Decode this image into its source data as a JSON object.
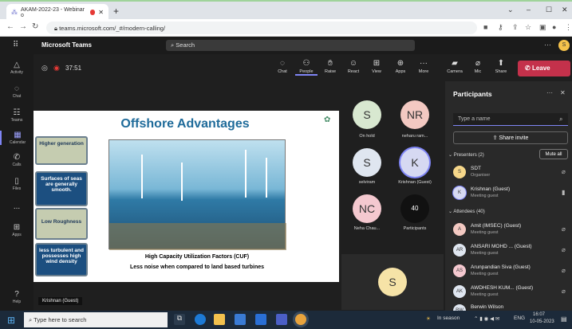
{
  "browser": {
    "tab_title": "AKAM-2022-23 - Webinar o",
    "tab_close": "✕",
    "new_tab": "+",
    "url": "teams.microsoft.com/_#/modern-calling/",
    "window_controls": [
      "⌄",
      "–",
      "☐",
      "✕"
    ]
  },
  "teams": {
    "app_title": "Microsoft Teams",
    "search_placeholder": "Search",
    "user_initial": "S"
  },
  "rail": [
    {
      "label": "Activity",
      "icon": "bell-icon"
    },
    {
      "label": "Chat",
      "icon": "chat-icon"
    },
    {
      "label": "Teams",
      "icon": "teams-icon"
    },
    {
      "label": "Calendar",
      "icon": "calendar-icon"
    },
    {
      "label": "Calls",
      "icon": "phone-icon"
    },
    {
      "label": "Files",
      "icon": "file-icon"
    },
    {
      "label": "...",
      "icon": "more-icon"
    },
    {
      "label": "Apps",
      "icon": "apps-icon"
    },
    {
      "label": "Help",
      "icon": "help-icon"
    }
  ],
  "meeting": {
    "timer": "37:51",
    "toolbar": [
      "Chat",
      "People",
      "Raise",
      "React",
      "View",
      "Apps",
      "More",
      "Camera",
      "Mic",
      "Share"
    ],
    "leave": "Leave"
  },
  "slide": {
    "title": "Offshore Advantages",
    "boxes": [
      "Higher generation",
      "Surfaces of seas are generally smooth.",
      "Low Roughness",
      "less turbulent and possesses high wind density"
    ],
    "caption1": "High Capacity Utilization Factors (CUF)",
    "caption2": "Less noise when compared to land based turbines"
  },
  "tiles": [
    {
      "initials": "S",
      "name": "On hold",
      "color": "#d8e8d0"
    },
    {
      "initials": "NR",
      "name": "neharu ram...",
      "color": "#f3c9c2"
    },
    {
      "initials": "S",
      "name": "selviram",
      "color": "#dfe6f0"
    },
    {
      "initials": "K",
      "name": "Krishnan (Guest)",
      "color": "#d6d9f2"
    },
    {
      "initials": "NC",
      "name": "Neha Chau...",
      "color": "#f4c8cf"
    },
    {
      "initials": "40",
      "name": "Participants",
      "color": "#111111"
    }
  ],
  "self_view": {
    "initials": "S",
    "color": "#f6e3a7"
  },
  "presenter_tag": "Krishnan (Guest)",
  "panel": {
    "title": "Participants",
    "search_placeholder": "Type a name",
    "share_invite": "Share invite",
    "presenters_header": "Presenters (2)",
    "mute_all": "Mute all",
    "attendees_header": "Attendees (40)",
    "presenters": [
      {
        "initials": "S",
        "name": "SDT",
        "role": "Organiser",
        "color": "#f6d78a"
      },
      {
        "initials": "K",
        "name": "Krishnan (Guest)",
        "role": "Meeting guest",
        "color": "#d6d9f2"
      }
    ],
    "attendees": [
      {
        "initials": "A",
        "name": "Amit (IMSEC) (Guest)",
        "role": "Meeting guest",
        "color": "#f3c9c2"
      },
      {
        "initials": "AR",
        "name": "ANSARI MOHD ... (Guest)",
        "role": "Meeting guest",
        "color": "#dfe6f0"
      },
      {
        "initials": "AS",
        "name": "Arunpandian Siva (Guest)",
        "role": "Meeting guest",
        "color": "#f4c8cf"
      },
      {
        "initials": "AK",
        "name": "AWDHESH KUM... (Guest)",
        "role": "Meeting guest",
        "color": "#dfe6f0"
      },
      {
        "initials": "BW",
        "name": "Berwin Wilson",
        "role": "",
        "color": "#dfe6f0"
      }
    ]
  },
  "taskbar": {
    "search": "Type here to search",
    "weather": "In season",
    "lang": "ENG",
    "time": "16:07",
    "date": "10-05-2023"
  }
}
